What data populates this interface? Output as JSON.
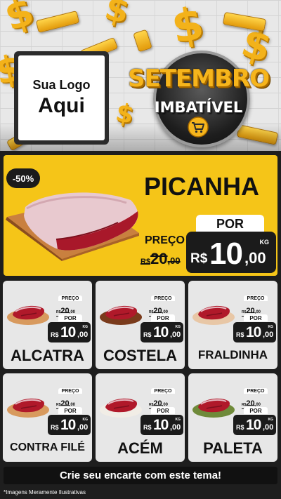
{
  "header": {
    "logo_line1": "Sua Logo",
    "logo_line2": "Aqui",
    "title_line1": "SETEMBRO",
    "title_line2": "IMBATÍVEL",
    "icons": [
      "dollar-sign-icon",
      "coin-bar-icon",
      "shopping-cart-icon"
    ]
  },
  "featured": {
    "discount": "-50%",
    "name": "PICANHA",
    "preco_label": "PREÇO",
    "old_currency": "R$",
    "old_int": "20",
    "old_dec": ",00",
    "por_label": "POR",
    "currency": "R$",
    "price_int": "10",
    "price_dec": ",00",
    "unit": "KG"
  },
  "products": [
    {
      "name": "ALCATRA",
      "preco_label": "PREÇO",
      "old_currency": "R$",
      "old_int": "20",
      "old_dec": ",00",
      "por_label": "POR",
      "currency": "R$",
      "price_int": "10",
      "price_dec": ",00",
      "unit": "KG"
    },
    {
      "name": "COSTELA",
      "preco_label": "PREÇO",
      "old_currency": "R$",
      "old_int": "20",
      "old_dec": ",00",
      "por_label": "POR",
      "currency": "R$",
      "price_int": "10",
      "price_dec": ",00",
      "unit": "KG"
    },
    {
      "name": "FRALDINHA",
      "preco_label": "PREÇO",
      "old_currency": "R$",
      "old_int": "20",
      "old_dec": ",00",
      "por_label": "POR",
      "currency": "R$",
      "price_int": "10",
      "price_dec": ",00",
      "unit": "KG"
    },
    {
      "name": "CONTRA FILÉ",
      "preco_label": "PREÇO",
      "old_currency": "R$",
      "old_int": "20",
      "old_dec": ",00",
      "por_label": "POR",
      "currency": "R$",
      "price_int": "10",
      "price_dec": ",00",
      "unit": "KG"
    },
    {
      "name": "ACÉM",
      "preco_label": "PREÇO",
      "old_currency": "R$",
      "old_int": "20",
      "old_dec": ",00",
      "por_label": "POR",
      "currency": "R$",
      "price_int": "10",
      "price_dec": ",00",
      "unit": "KG"
    },
    {
      "name": "PALETA",
      "preco_label": "PREÇO",
      "old_currency": "R$",
      "old_int": "20",
      "old_dec": ",00",
      "por_label": "POR",
      "currency": "R$",
      "price_int": "10",
      "price_dec": ",00",
      "unit": "KG"
    }
  ],
  "cta": "Crie seu encarte com este tema!",
  "disclaimer": "*Imagens Meramente Ilustrativas",
  "colors": {
    "accent_yellow": "#f5c518",
    "dark": "#1e1e1e",
    "card_bg": "#e7e7e7",
    "gold": "#f3b21a",
    "meat_red": "#b0192a"
  }
}
